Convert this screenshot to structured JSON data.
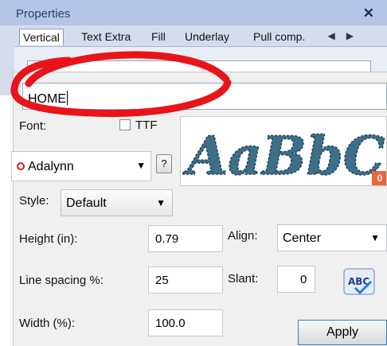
{
  "panel": {
    "title": "Properties",
    "close_icon": "close-icon",
    "tabs": [
      "Vertical",
      "Text Extra",
      "Fill",
      "Underlay",
      "Pull comp."
    ],
    "active_tab": "Vertical",
    "scroll_icons": [
      "arrow-left-icon",
      "arrow-right-icon"
    ]
  },
  "text": {
    "value": "HOME"
  },
  "font": {
    "label": "Font:",
    "ttf_label": "TTF",
    "ttf_checked": false,
    "selected": "Adalynn",
    "help_label": "?",
    "preview_text": "AaBbCc",
    "preview_badge": "0"
  },
  "style": {
    "label": "Style:",
    "value": "Default"
  },
  "height": {
    "label": "Height (in):",
    "value": "0.79"
  },
  "align": {
    "label": "Align:",
    "value": "Center"
  },
  "line_spacing": {
    "label": "Line spacing %:",
    "value": "25"
  },
  "slant": {
    "label": "Slant:",
    "value": "0"
  },
  "width": {
    "label": "Width (%):",
    "value": "100.0"
  },
  "spellcheck": {
    "label": "ABC"
  },
  "apply": {
    "label": "Apply"
  },
  "colors": {
    "annotation": "#e8131b",
    "preview_text": "#3d6f8a",
    "titlebar": "#b4c6e7"
  }
}
